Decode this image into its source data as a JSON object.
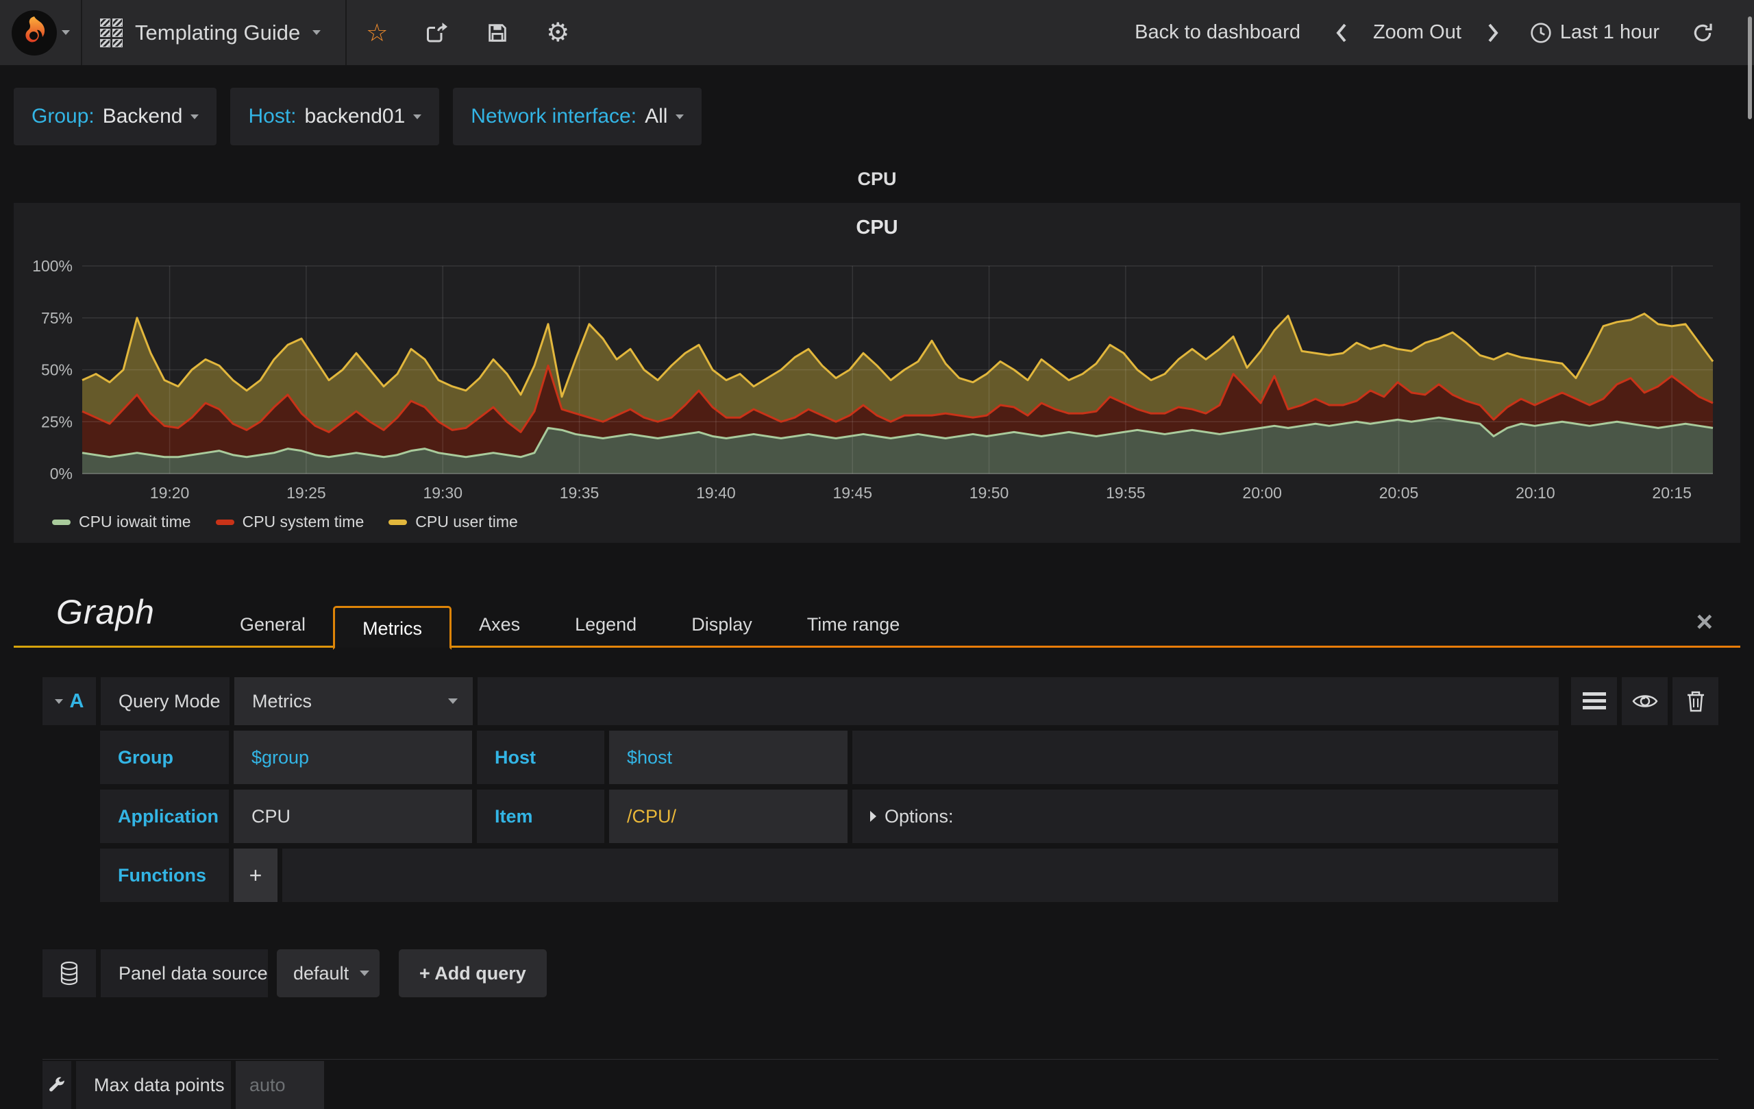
{
  "navbar": {
    "title": "Templating Guide",
    "back_to_dashboard": "Back to dashboard",
    "zoom_out": "Zoom Out",
    "time_range": "Last 1 hour"
  },
  "icons": {
    "star": "☆",
    "gear": "⚙",
    "close": "×"
  },
  "variables": {
    "group": {
      "label": "Group:",
      "value": "Backend"
    },
    "host": {
      "label": "Host:",
      "value": "backend01"
    },
    "network": {
      "label": "Network interface:",
      "value": "All"
    }
  },
  "panel": {
    "row_title": "CPU",
    "chart_title": "CPU"
  },
  "chart_data": {
    "type": "area",
    "stacked": true,
    "title": "CPU",
    "ylabel": "",
    "xlabel": "",
    "ylim": [
      0,
      100
    ],
    "y_ticks": {
      "values": [
        0,
        25,
        50,
        75,
        100
      ],
      "labels": [
        "0%",
        "25%",
        "50%",
        "75%",
        "100%"
      ]
    },
    "x_range": [
      "19:16:48",
      "20:16:30"
    ],
    "x_ticks": [
      "19:20",
      "19:25",
      "19:30",
      "19:35",
      "19:40",
      "19:45",
      "19:50",
      "19:55",
      "20:00",
      "20:05",
      "20:10",
      "20:15"
    ],
    "legend_position": "bottom-left",
    "grid": true,
    "series": [
      {
        "name": "CPU iowait time",
        "line_color": "#a9cb9c",
        "fill_color": "#4a5647",
        "values": [
          10,
          9,
          8,
          9,
          10,
          9,
          8,
          8,
          9,
          10,
          11,
          9,
          8,
          9,
          10,
          12,
          11,
          9,
          8,
          9,
          10,
          9,
          8,
          9,
          11,
          12,
          10,
          9,
          8,
          9,
          10,
          9,
          8,
          10,
          22,
          21,
          19,
          18,
          17,
          18,
          19,
          18,
          17,
          18,
          19,
          20,
          18,
          17,
          18,
          19,
          18,
          17,
          18,
          19,
          18,
          17,
          18,
          19,
          18,
          17,
          18,
          19,
          18,
          17,
          18,
          19,
          18,
          19,
          20,
          19,
          18,
          19,
          20,
          19,
          18,
          19,
          20,
          21,
          20,
          19,
          20,
          21,
          20,
          19,
          20,
          21,
          22,
          23,
          22,
          23,
          24,
          23,
          24,
          25,
          24,
          25,
          26,
          25,
          26,
          27,
          26,
          25,
          24,
          18,
          22,
          24,
          23,
          24,
          25,
          24,
          23,
          24,
          25,
          24,
          23,
          22,
          23,
          24,
          23,
          22
        ]
      },
      {
        "name": "CPU system time",
        "line_color": "#c93318",
        "fill_color": "#4e1d13",
        "values": [
          20,
          18,
          16,
          22,
          28,
          20,
          15,
          14,
          18,
          24,
          20,
          15,
          13,
          16,
          22,
          26,
          18,
          14,
          12,
          16,
          20,
          16,
          13,
          18,
          24,
          20,
          15,
          12,
          14,
          18,
          22,
          16,
          12,
          20,
          30,
          10,
          10,
          9,
          8,
          10,
          12,
          9,
          8,
          9,
          14,
          20,
          14,
          10,
          9,
          12,
          10,
          8,
          9,
          12,
          10,
          8,
          10,
          14,
          10,
          8,
          10,
          9,
          10,
          12,
          10,
          8,
          10,
          14,
          12,
          9,
          16,
          12,
          9,
          10,
          12,
          18,
          14,
          10,
          9,
          10,
          12,
          10,
          9,
          14,
          28,
          20,
          12,
          24,
          9,
          10,
          12,
          10,
          9,
          10,
          16,
          12,
          18,
          14,
          12,
          16,
          12,
          10,
          9,
          8,
          10,
          12,
          10,
          12,
          14,
          12,
          10,
          12,
          18,
          22,
          16,
          20,
          24,
          18,
          14,
          12
        ]
      },
      {
        "name": "CPU user time",
        "line_color": "#e2b73d",
        "fill_color": "#665a2a",
        "values": [
          15,
          21,
          20,
          19,
          37,
          29,
          22,
          20,
          23,
          21,
          21,
          21,
          19,
          20,
          23,
          24,
          36,
          32,
          25,
          25,
          28,
          25,
          21,
          21,
          25,
          23,
          20,
          21,
          18,
          19,
          23,
          23,
          18,
          22,
          20,
          6,
          26,
          45,
          40,
          27,
          29,
          23,
          20,
          25,
          25,
          22,
          18,
          18,
          21,
          11,
          18,
          25,
          29,
          29,
          24,
          21,
          22,
          25,
          24,
          20,
          22,
          26,
          36,
          24,
          18,
          17,
          20,
          21,
          18,
          17,
          21,
          19,
          16,
          19,
          23,
          25,
          24,
          19,
          16,
          19,
          23,
          29,
          26,
          27,
          18,
          10,
          25,
          22,
          45,
          26,
          22,
          24,
          25,
          28,
          20,
          25,
          16,
          20,
          25,
          22,
          30,
          28,
          24,
          29,
          26,
          20,
          22,
          18,
          14,
          10,
          25,
          35,
          30,
          28,
          38,
          30,
          24,
          30,
          26,
          20
        ]
      }
    ]
  },
  "editor": {
    "panel_type": "Graph",
    "tabs": [
      "General",
      "Metrics",
      "Axes",
      "Legend",
      "Display",
      "Time range"
    ],
    "active_tab": "Metrics",
    "query": {
      "letter": "A",
      "mode_label": "Query Mode",
      "mode_value": "Metrics",
      "group_label": "Group",
      "group_value": "$group",
      "host_label": "Host",
      "host_value": "$host",
      "application_label": "Application",
      "application_value": "CPU",
      "item_label": "Item",
      "item_value": "/CPU/",
      "options_label": "Options:",
      "functions_label": "Functions",
      "add_function": "+"
    },
    "datasource": {
      "label": "Panel data source",
      "value": "default",
      "add_query": "+ Add query"
    },
    "max_data_points": {
      "label": "Max data points",
      "placeholder": "auto"
    },
    "accent_cyan": "#33b5e5",
    "accent_orange": "#dd8408",
    "item_value_color": "#eab839"
  }
}
